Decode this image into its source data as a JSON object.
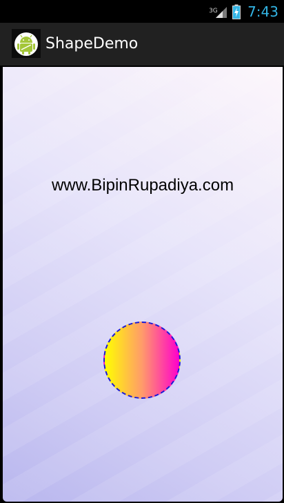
{
  "status_bar": {
    "network_type": "3G",
    "time": "7:43",
    "icons": [
      "signal-icon",
      "battery-charging-icon"
    ],
    "clock_color": "#33b5e5"
  },
  "action_bar": {
    "title": "ShapeDemo",
    "icon": "android-app-icon"
  },
  "content": {
    "url_text": "www.BipinRupadiya.com",
    "shape": {
      "type": "oval",
      "gradient_colors": [
        "#ffff00",
        "#ff00cc"
      ],
      "stroke_color": "#1a1ad6",
      "stroke_style": "dashed"
    },
    "background_colors": [
      "#fdf6fb",
      "#b8b6ee"
    ]
  }
}
